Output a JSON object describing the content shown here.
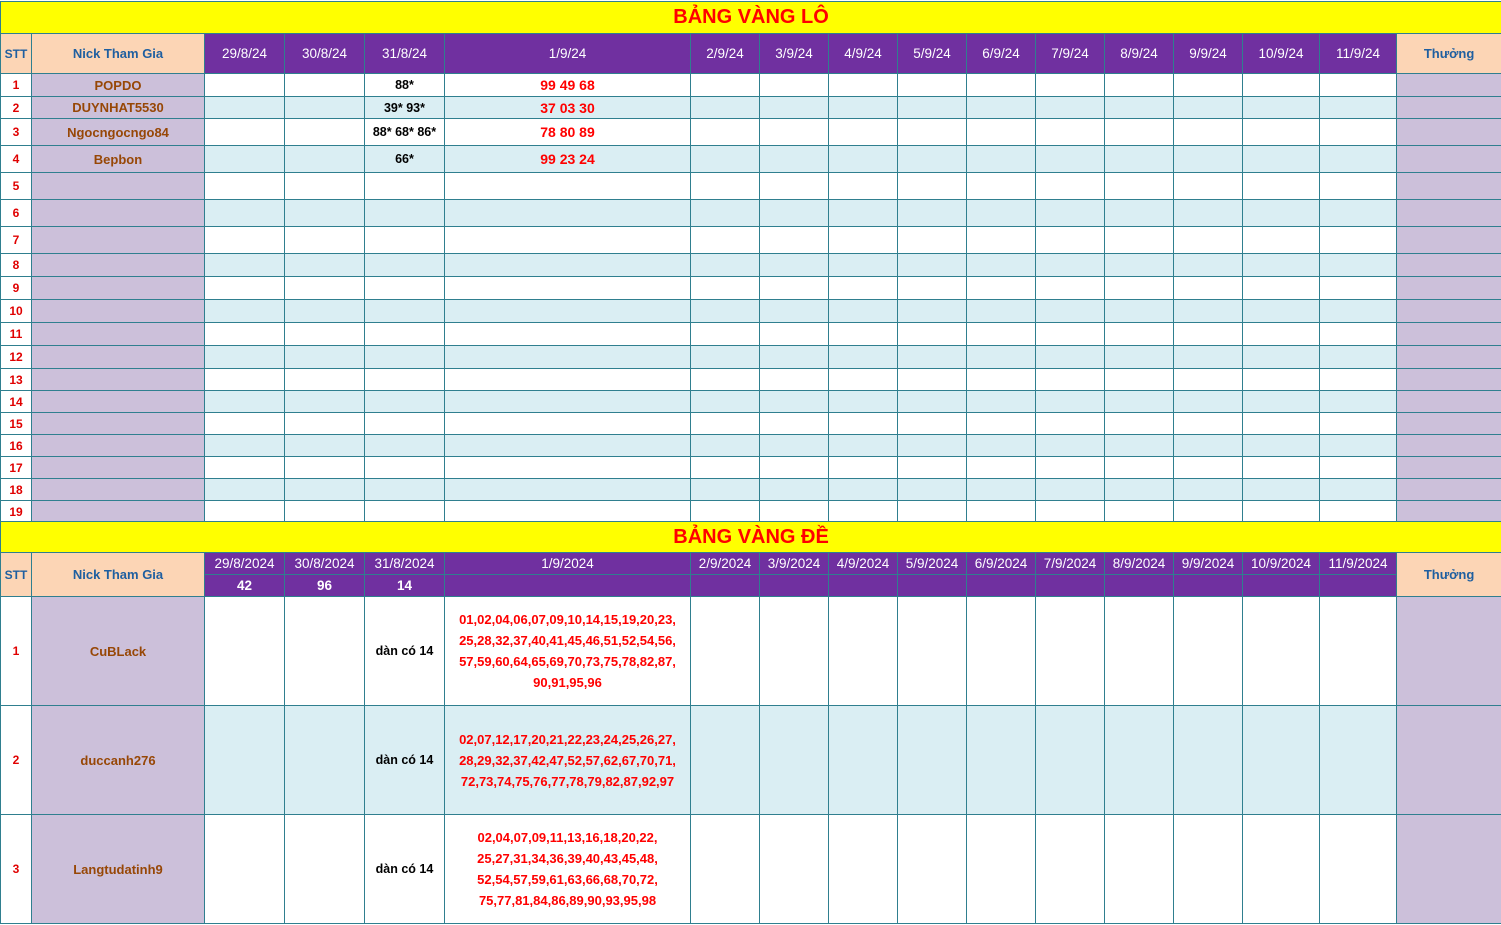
{
  "lo": {
    "title": "BẢNG VÀNG LÔ",
    "stt_header": "STT",
    "nick_header": "Nick Tham Gia",
    "bonus_header": "Thưởng",
    "dates": [
      "29/8/24",
      "30/8/24",
      "31/8/24",
      "1/9/24",
      "2/9/24",
      "3/9/24",
      "4/9/24",
      "5/9/24",
      "6/9/24",
      "7/9/24",
      "8/9/24",
      "9/9/24",
      "10/9/24",
      "11/9/24"
    ],
    "rows": [
      {
        "stt": "1",
        "nick": "POPDO",
        "d31": "88*",
        "d1": "99 49 68"
      },
      {
        "stt": "2",
        "nick": "DUYNHAT5530",
        "d31": "39* 93*",
        "d1": "37 03 30"
      },
      {
        "stt": "3",
        "nick": "Ngocngocngo84",
        "d31": "88* 68* 86*",
        "d1": "78 80 89"
      },
      {
        "stt": "4",
        "nick": "Bepbon",
        "d31": "66*",
        "d1": "99 23 24"
      },
      {
        "stt": "5",
        "nick": "",
        "d31": "",
        "d1": ""
      },
      {
        "stt": "6",
        "nick": "",
        "d31": "",
        "d1": ""
      },
      {
        "stt": "7",
        "nick": "",
        "d31": "",
        "d1": ""
      },
      {
        "stt": "8",
        "nick": "",
        "d31": "",
        "d1": ""
      },
      {
        "stt": "9",
        "nick": "",
        "d31": "",
        "d1": ""
      },
      {
        "stt": "10",
        "nick": "",
        "d31": "",
        "d1": ""
      },
      {
        "stt": "11",
        "nick": "",
        "d31": "",
        "d1": ""
      },
      {
        "stt": "12",
        "nick": "",
        "d31": "",
        "d1": ""
      },
      {
        "stt": "13",
        "nick": "",
        "d31": "",
        "d1": ""
      },
      {
        "stt": "14",
        "nick": "",
        "d31": "",
        "d1": ""
      },
      {
        "stt": "15",
        "nick": "",
        "d31": "",
        "d1": ""
      },
      {
        "stt": "16",
        "nick": "",
        "d31": "",
        "d1": ""
      },
      {
        "stt": "17",
        "nick": "",
        "d31": "",
        "d1": ""
      },
      {
        "stt": "18",
        "nick": "",
        "d31": "",
        "d1": ""
      },
      {
        "stt": "19",
        "nick": "",
        "d31": "",
        "d1": ""
      }
    ]
  },
  "de": {
    "title": "BẢNG VÀNG ĐỀ",
    "stt_header": "STT",
    "nick_header": "Nick Tham Gia",
    "bonus_header": "Thưởng",
    "dates": [
      "29/8/2024",
      "30/8/2024",
      "31/8/2024",
      "1/9/2024",
      "2/9/2024",
      "3/9/2024",
      "4/9/2024",
      "5/9/2024",
      "6/9/2024",
      "7/9/2024",
      "8/9/2024",
      "9/9/2024",
      "10/9/2024",
      "11/9/2024"
    ],
    "results": [
      "42",
      "96",
      "14",
      "",
      "",
      "",
      "",
      "",
      "",
      "",
      "",
      "",
      "",
      ""
    ],
    "rows": [
      {
        "stt": "1",
        "nick": "CuBLack",
        "d31": "dàn có 14",
        "d1_lines": [
          "01,02,04,06,07,09,10,14,15,19,20,23,",
          "25,28,32,37,40,41,45,46,51,52,54,56,",
          "57,59,60,64,65,69,70,73,75,78,82,87,",
          "90,91,95,96"
        ]
      },
      {
        "stt": "2",
        "nick": "duccanh276",
        "d31": "dàn có 14",
        "d1_lines": [
          "02,07,12,17,20,21,22,23,24,25,26,27,",
          "28,29,32,37,42,47,52,57,62,67,70,71,",
          "72,73,74,75,76,77,78,79,82,87,92,97"
        ]
      },
      {
        "stt": "3",
        "nick": "Langtudatinh9",
        "d31": "dàn có 14",
        "d1_lines": [
          "02,04,07,09,11,13,16,18,20,22,",
          "25,27,31,34,36,39,40,43,45,48,",
          "52,54,57,59,61,63,66,68,70,72,",
          "75,77,81,84,86,89,90,93,95,98"
        ]
      }
    ]
  }
}
